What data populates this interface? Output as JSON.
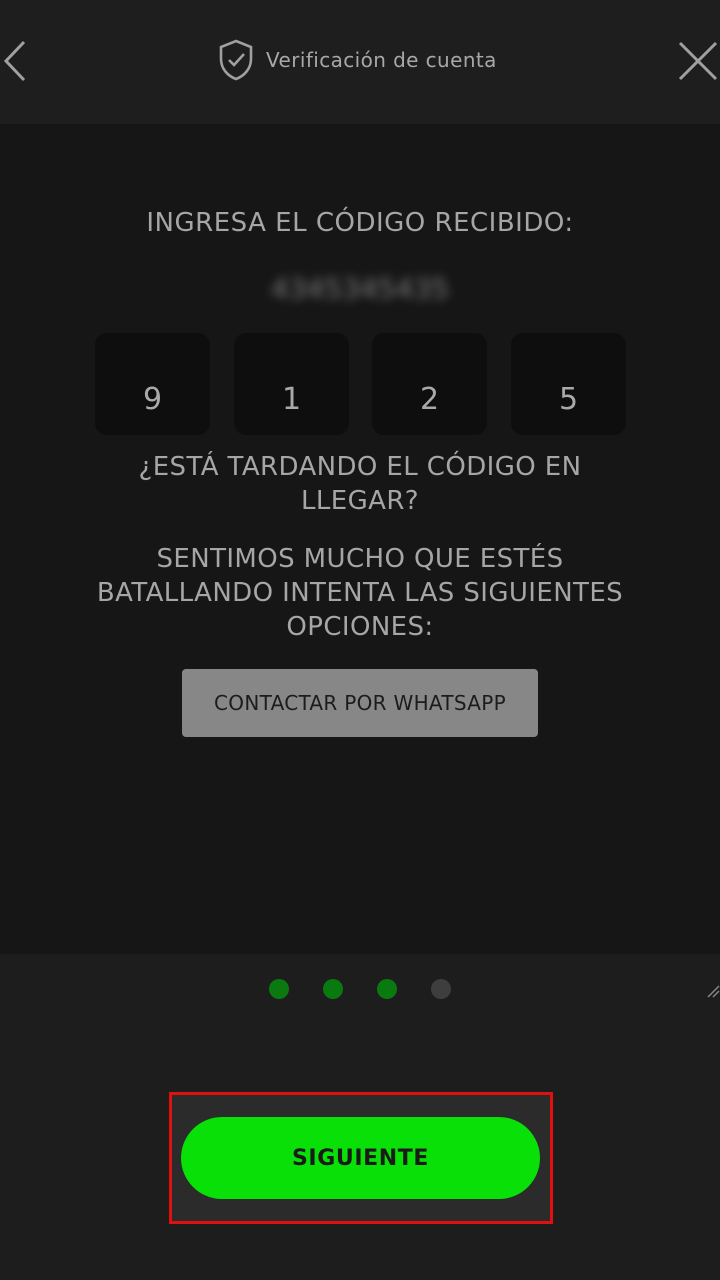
{
  "header": {
    "title": "Verificación de cuenta",
    "back_icon": "chevron-left-icon",
    "close_icon": "close-icon",
    "title_icon": "shield-check-icon"
  },
  "main": {
    "heading": "INGRESA EL CÓDIGO RECIBIDO:",
    "phone_number": "4345345435",
    "code_digits": [
      "9",
      "1",
      "2",
      "5"
    ],
    "delay_question_line1": "¿ESTÁ TARDANDO EL CÓDIGO EN",
    "delay_question_line2": "LLEGAR?",
    "help_line1": "SENTIMOS MUCHO QUE ESTÉS",
    "help_line2": "BATALLANDO INTENTA LAS SIGUIENTES",
    "help_line3": "OPCIONES:",
    "whatsapp_button": "CONTACTAR POR WHATSAPP"
  },
  "pager": {
    "total": 4,
    "active_count": 3,
    "active_color": "#0a7a10",
    "inactive_color": "#3e3e3e"
  },
  "footer": {
    "next_button": "SIGUIENTE",
    "next_color": "#09e007",
    "highlight_color": "#e11010"
  }
}
